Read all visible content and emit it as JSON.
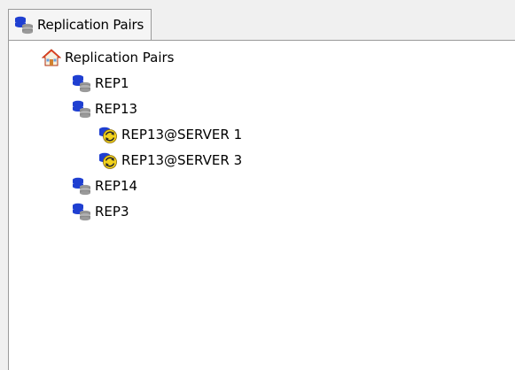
{
  "tab": {
    "icon": "database-stack-icon",
    "label": "Replication Pairs"
  },
  "tree": {
    "root": {
      "icon": "home-icon",
      "label": "Replication Pairs"
    },
    "items": [
      {
        "icon": "database-stack-icon",
        "label": "REP1"
      },
      {
        "icon": "database-stack-icon",
        "label": "REP13"
      },
      {
        "icon": "replication-server-icon",
        "label": "REP13@SERVER 1"
      },
      {
        "icon": "replication-server-icon",
        "label": "REP13@SERVER 3"
      },
      {
        "icon": "database-stack-icon",
        "label": "REP14"
      },
      {
        "icon": "database-stack-icon",
        "label": "REP3"
      }
    ]
  },
  "colors": {
    "panel_bg": "#ffffff",
    "window_bg": "#f0f0f0",
    "border": "#9a9a9a",
    "db_blue": "#1f3fd1",
    "db_gray": "#8a8a8a",
    "sync_yellow": "#f2d21c",
    "home_red": "#e04020"
  }
}
